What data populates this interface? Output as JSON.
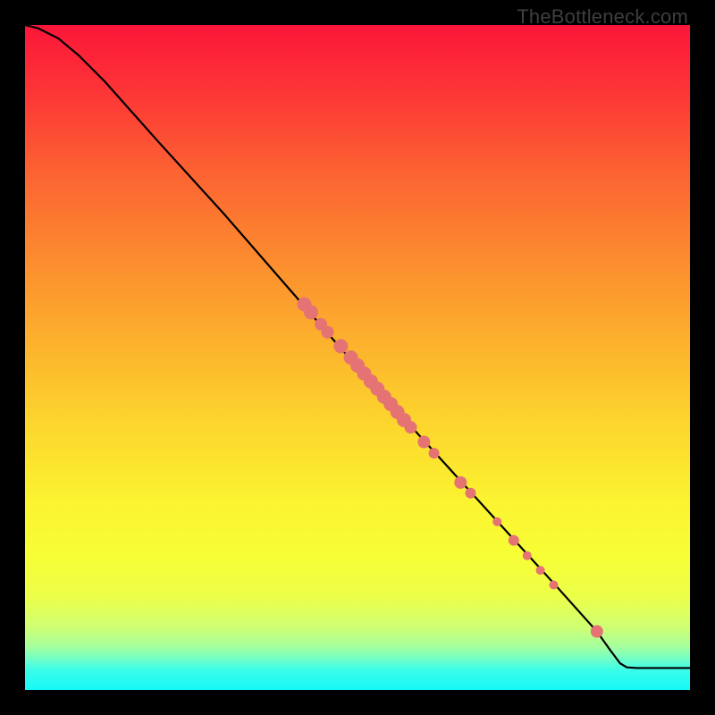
{
  "watermark": "TheBottleneck.com",
  "chart_data": {
    "type": "line",
    "title": "",
    "xlabel": "",
    "ylabel": "",
    "xlim": [
      0,
      100
    ],
    "ylim": [
      0,
      100
    ],
    "background_gradient": {
      "stops": [
        {
          "offset": 0.0,
          "color": "#fb1639"
        },
        {
          "offset": 0.1,
          "color": "#fc3536"
        },
        {
          "offset": 0.22,
          "color": "#fc6232"
        },
        {
          "offset": 0.35,
          "color": "#fc8b2f"
        },
        {
          "offset": 0.48,
          "color": "#fcb22d"
        },
        {
          "offset": 0.6,
          "color": "#fcd62d"
        },
        {
          "offset": 0.72,
          "color": "#fbf430"
        },
        {
          "offset": 0.8,
          "color": "#f7fe36"
        },
        {
          "offset": 0.86,
          "color": "#ecff49"
        },
        {
          "offset": 0.905,
          "color": "#cfff72"
        },
        {
          "offset": 0.935,
          "color": "#a4ff9d"
        },
        {
          "offset": 0.955,
          "color": "#6cffcb"
        },
        {
          "offset": 0.97,
          "color": "#3bfde9"
        },
        {
          "offset": 1.0,
          "color": "#16f8f8"
        }
      ]
    },
    "series": [
      {
        "name": "curve",
        "type": "line",
        "points": [
          {
            "x": 0.0,
            "y": 100.0
          },
          {
            "x": 2.0,
            "y": 99.5
          },
          {
            "x": 5.0,
            "y": 98.0
          },
          {
            "x": 8.0,
            "y": 95.5
          },
          {
            "x": 12.0,
            "y": 91.5
          },
          {
            "x": 16.0,
            "y": 87.0
          },
          {
            "x": 20.0,
            "y": 82.5
          },
          {
            "x": 30.0,
            "y": 71.5
          },
          {
            "x": 40.0,
            "y": 60.0
          },
          {
            "x": 50.0,
            "y": 48.5
          },
          {
            "x": 60.0,
            "y": 37.5
          },
          {
            "x": 70.0,
            "y": 26.5
          },
          {
            "x": 80.0,
            "y": 15.5
          },
          {
            "x": 86.0,
            "y": 8.8
          },
          {
            "x": 88.0,
            "y": 6.0
          },
          {
            "x": 89.5,
            "y": 4.0
          },
          {
            "x": 90.5,
            "y": 3.4
          },
          {
            "x": 92.0,
            "y": 3.3
          },
          {
            "x": 100.0,
            "y": 3.3
          }
        ]
      },
      {
        "name": "highlighted-points",
        "type": "scatter",
        "points": [
          {
            "x": 42.0,
            "y": 58.0,
            "r": 8
          },
          {
            "x": 43.0,
            "y": 56.8,
            "r": 8
          },
          {
            "x": 44.5,
            "y": 55.0,
            "r": 7
          },
          {
            "x": 45.5,
            "y": 53.8,
            "r": 7
          },
          {
            "x": 47.5,
            "y": 51.7,
            "r": 8
          },
          {
            "x": 49.0,
            "y": 50.0,
            "r": 8
          },
          {
            "x": 50.0,
            "y": 48.8,
            "r": 8
          },
          {
            "x": 51.0,
            "y": 47.6,
            "r": 8
          },
          {
            "x": 52.0,
            "y": 46.4,
            "r": 8
          },
          {
            "x": 53.0,
            "y": 45.3,
            "r": 8
          },
          {
            "x": 54.0,
            "y": 44.1,
            "r": 8
          },
          {
            "x": 55.0,
            "y": 43.0,
            "r": 8
          },
          {
            "x": 56.0,
            "y": 41.8,
            "r": 8
          },
          {
            "x": 57.0,
            "y": 40.6,
            "r": 8
          },
          {
            "x": 58.0,
            "y": 39.5,
            "r": 7
          },
          {
            "x": 60.0,
            "y": 37.3,
            "r": 7
          },
          {
            "x": 61.5,
            "y": 35.6,
            "r": 6
          },
          {
            "x": 65.5,
            "y": 31.2,
            "r": 7
          },
          {
            "x": 67.0,
            "y": 29.6,
            "r": 6
          },
          {
            "x": 71.0,
            "y": 25.3,
            "r": 5
          },
          {
            "x": 73.5,
            "y": 22.5,
            "r": 6
          },
          {
            "x": 75.5,
            "y": 20.2,
            "r": 5
          },
          {
            "x": 77.5,
            "y": 18.0,
            "r": 5
          },
          {
            "x": 79.5,
            "y": 15.8,
            "r": 5
          },
          {
            "x": 86.0,
            "y": 8.8,
            "r": 7
          }
        ]
      }
    ]
  }
}
